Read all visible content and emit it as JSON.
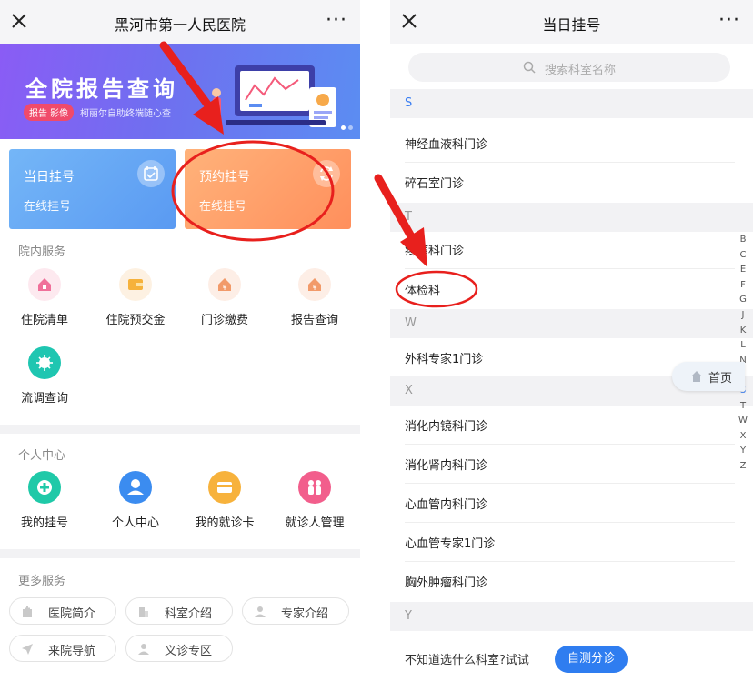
{
  "left": {
    "title": "黑河市第一人民医院",
    "more_label": "···",
    "banner": {
      "title": "全院报告查询",
      "tag": "报告 影像",
      "subtitle": "柯丽尔自助终端随心查"
    },
    "cards": [
      {
        "title": "当日挂号",
        "subtitle": "在线挂号",
        "color": "#6aa8f5"
      },
      {
        "title": "预约挂号",
        "subtitle": "在线挂号",
        "color": "#ff9a66"
      }
    ],
    "inpatient_section": "院内服务",
    "inpatient_services": [
      {
        "label": "住院清单",
        "icon": "house-list-icon"
      },
      {
        "label": "住院预交金",
        "icon": "wallet-icon"
      },
      {
        "label": "门诊缴费",
        "icon": "payment-icon"
      },
      {
        "label": "报告查询",
        "icon": "report-icon"
      },
      {
        "label": "流调查询",
        "icon": "virus-icon"
      }
    ],
    "personal_section": "个人中心",
    "personal_services": [
      {
        "label": "我的挂号",
        "icon": "plus-circle-icon"
      },
      {
        "label": "个人中心",
        "icon": "user-icon"
      },
      {
        "label": "我的就诊卡",
        "icon": "card-icon"
      },
      {
        "label": "就诊人管理",
        "icon": "people-icon"
      }
    ],
    "more_section": "更多服务",
    "more_services": [
      {
        "label": "医院简介",
        "icon": "hospital-icon"
      },
      {
        "label": "科室介绍",
        "icon": "building-icon"
      },
      {
        "label": "专家介绍",
        "icon": "doctor-icon"
      },
      {
        "label": "来院导航",
        "icon": "navigation-icon"
      },
      {
        "label": "义诊专区",
        "icon": "person-icon"
      }
    ]
  },
  "right": {
    "title": "当日挂号",
    "more_label": "···",
    "search_placeholder": "搜索科室名称",
    "groups": [
      {
        "letter": "S",
        "items": [
          "神经血液科门诊",
          "碎石室门诊"
        ]
      },
      {
        "letter": "T",
        "items": [
          "疼痛科门诊",
          "体检科"
        ]
      },
      {
        "letter": "W",
        "items": [
          "外科专家1门诊"
        ]
      },
      {
        "letter": "X",
        "items": [
          "消化内镜科门诊",
          "消化肾内科门诊",
          "心血管内科门诊",
          "心血管专家1门诊",
          "胸外肿瘤科门诊"
        ]
      },
      {
        "letter": "Y",
        "items": []
      }
    ],
    "alphabet": [
      "B",
      "C",
      "E",
      "F",
      "G",
      "J",
      "K",
      "L",
      "N",
      "",
      "S",
      "T",
      "W",
      "X",
      "Y",
      "Z"
    ],
    "active_letter": "S",
    "home_label": "首页",
    "bottom_question": "不知道选什么科室?试试",
    "self_triage_label": "自测分诊"
  },
  "colors": {
    "accent_blue": "#2f7df0",
    "annotation_red": "#e8201d"
  }
}
